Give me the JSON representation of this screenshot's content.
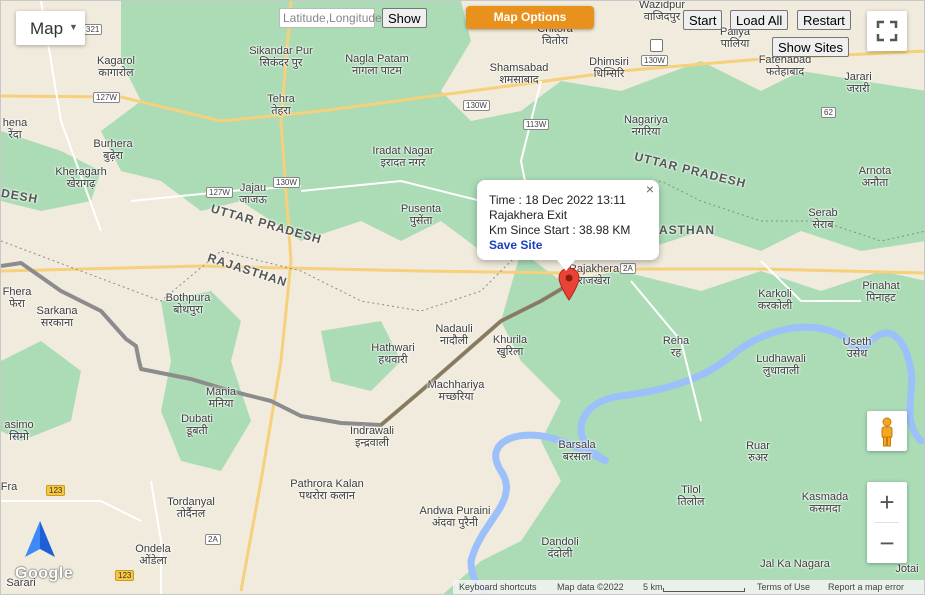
{
  "map_type": {
    "label": "Map"
  },
  "coord_search": {
    "placeholder": "Latitude,Longitude",
    "button": "Show"
  },
  "map_options": {
    "label": "Map Options"
  },
  "top_buttons": {
    "start": "Start",
    "load_all": "Load All",
    "restart": "Restart",
    "show_sites": "Show Sites"
  },
  "info_window": {
    "time": "Time : 18 Dec 2022 13:11",
    "location": "Rajakhera Exit",
    "km": "Km Since Start : 38.98 KM",
    "save": "Save Site"
  },
  "states": [
    "UTTAR PRADESH",
    "RAJASTHAN",
    "DESH"
  ],
  "roads": [
    "321",
    "127W",
    "127W",
    "130W",
    "130W",
    "113W",
    "130W",
    "62",
    "2A",
    "2A",
    "123",
    "123"
  ],
  "places": [
    {
      "en": "Kagarol",
      "hi": "कागारोल"
    },
    {
      "en": "Sikandar Pur",
      "hi": "सिकंदर पुर"
    },
    {
      "en": "Nagla Patam",
      "hi": "नागला पाटम"
    },
    {
      "en": "Chitora",
      "hi": "चितोरा"
    },
    {
      "en": "Shamsabad",
      "hi": "शमसाबाद"
    },
    {
      "en": "Dhimsiri",
      "hi": "धिम्सिरि"
    },
    {
      "en": "Wazidpur",
      "hi": "वाजिदपुर"
    },
    {
      "en": "Paliya",
      "hi": "पालिया"
    },
    {
      "en": "Fatehabad",
      "hi": "फतेहाबाद"
    },
    {
      "en": "Jarari",
      "hi": "जरारी"
    },
    {
      "en": "Tehra",
      "hi": "तेहरा"
    },
    {
      "en": "Burhera",
      "hi": "बुढ़ेरा"
    },
    {
      "en": "Iradat Nagar",
      "hi": "इरादत नगर"
    },
    {
      "en": "Nagariya",
      "hi": "नगरिया"
    },
    {
      "en": "Kheragarh",
      "hi": "खेरागढ़"
    },
    {
      "en": "Jajau",
      "hi": "जाजऊ"
    },
    {
      "en": "Pusenta",
      "hi": "पुसेंता"
    },
    {
      "en": "Arnota",
      "hi": "अनौता"
    },
    {
      "en": "Serab",
      "hi": "सेराब"
    },
    {
      "en": "Rajakhera",
      "hi": "राजखेरा"
    },
    {
      "en": "Sarkana",
      "hi": "सरकाना"
    },
    {
      "en": "Bothpura",
      "hi": "बोथपुरा"
    },
    {
      "en": "Nadauli",
      "hi": "नादौली"
    },
    {
      "en": "Karkoli",
      "hi": "करकोली"
    },
    {
      "en": "Pinahat",
      "hi": "पिनाहट"
    },
    {
      "en": "Khurila",
      "hi": "खुरिला"
    },
    {
      "en": "Reha",
      "hi": "रह"
    },
    {
      "en": "Hathwari",
      "hi": "हथवारी"
    },
    {
      "en": "Useth",
      "hi": "उसेथ"
    },
    {
      "en": "Ludhawali",
      "hi": "लुधावाली"
    },
    {
      "en": "Mania",
      "hi": "मनिया"
    },
    {
      "en": "Machhariya",
      "hi": "मच्छरिया"
    },
    {
      "en": "Dubati",
      "hi": "डूबती"
    },
    {
      "en": "Indrawali",
      "hi": "इन्द्रवाली"
    },
    {
      "en": "Barsala",
      "hi": "बरसला"
    },
    {
      "en": "Ruar",
      "hi": "रुअर"
    },
    {
      "en": "Pathrora Kalan",
      "hi": "पथरोरा कलान"
    },
    {
      "en": "Tilol",
      "hi": "तिलोल"
    },
    {
      "en": "Kasmada",
      "hi": "कसमदा"
    },
    {
      "en": "Tordanyal",
      "hi": "तोर्दैनल"
    },
    {
      "en": "Andwa Puraini",
      "hi": "अंदवा पुरैनी"
    },
    {
      "en": "Dandoli",
      "hi": "दंदोली"
    },
    {
      "en": "Ondela",
      "hi": "ओंडेला"
    },
    {
      "en": "Jal Ka Nagara",
      "hi": ""
    },
    {
      "en": "Jotai",
      "hi": ""
    },
    {
      "en": "Sarari",
      "hi": ""
    },
    {
      "en": "Fhera",
      "hi": "फेरा"
    },
    {
      "en": "hena",
      "hi": "रेंदा"
    },
    {
      "en": "asimo",
      "hi": "सिमो"
    },
    {
      "en": "Fra",
      "hi": ""
    }
  ],
  "footer": {
    "logo": "Google",
    "shortcuts": "Keyboard shortcuts",
    "map_data": "Map data ©2022",
    "scale": "5 km",
    "terms": "Terms of Use",
    "report": "Report a map error"
  },
  "controls": {
    "zoom_in": "+",
    "zoom_out": "−"
  },
  "colors": {
    "map_land": "#f1ebdd",
    "forest": "#a9dbb5",
    "river": "#aac6ff",
    "route": "#808080",
    "accent_button": "#e8911d",
    "marker": "#e84335",
    "link": "#1a3fbf"
  }
}
